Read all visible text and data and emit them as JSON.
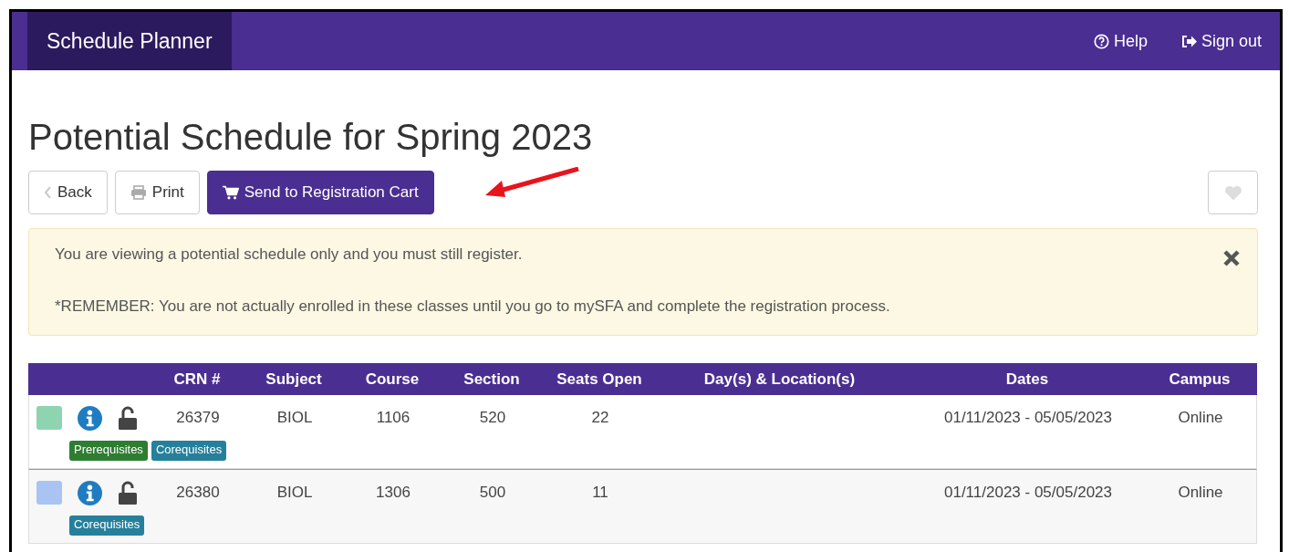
{
  "navbar": {
    "brand": "Schedule Planner",
    "links": [
      {
        "kind": "help",
        "label": "Help"
      },
      {
        "kind": "sign-out",
        "label": "Sign out"
      }
    ]
  },
  "title": "Potential Schedule for Spring 2023",
  "toolbar": {
    "buttons": [
      {
        "kind": "back",
        "label": "Back"
      },
      {
        "kind": "print",
        "label": "Print"
      },
      {
        "kind": "cart",
        "label": "Send to Registration Cart"
      }
    ]
  },
  "alert": {
    "lines": [
      "You are viewing a potential schedule only and you must still register.",
      "*REMEMBER: You are not actually enrolled in these classes until you go to mySFA and complete the registration process."
    ]
  },
  "table": {
    "columns": [
      "CRN #",
      "Subject",
      "Course",
      "Section",
      "Seats Open",
      "Day(s) & Location(s)",
      "Dates",
      "Campus"
    ],
    "rows": [
      {
        "color": "#8fd4b0",
        "crn": "26379",
        "subject": "BIOL",
        "course": "1106",
        "section": "520",
        "seats_open": "22",
        "dates": "01/11/2023 - 05/05/2023",
        "campus": "Online",
        "tags": [
          {
            "kind": "prerequisites",
            "label": "Prerequisites"
          },
          {
            "kind": "corequisites",
            "label": "Corequisites"
          }
        ]
      },
      {
        "color": "#a9c4f2",
        "crn": "26380",
        "subject": "BIOL",
        "course": "1306",
        "section": "500",
        "seats_open": "11",
        "dates": "01/11/2023 - 05/05/2023",
        "campus": "Online",
        "tags": [
          {
            "kind": "corequisites",
            "label": "Corequisites"
          }
        ]
      }
    ]
  }
}
